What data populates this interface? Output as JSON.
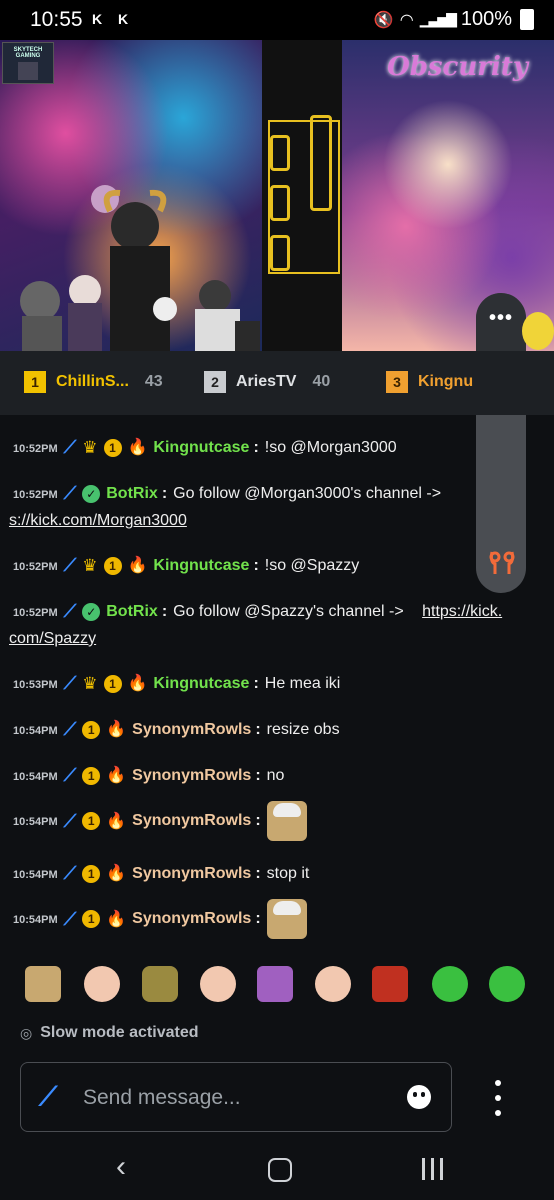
{
  "status_bar": {
    "time": "10:55",
    "notif_icons": [
      "K",
      "K"
    ],
    "battery": "100%"
  },
  "stream": {
    "overlay_title": "Obscurity",
    "sponsor_text": "SKYTECH GAMING"
  },
  "leaderboard": [
    {
      "rank": "1",
      "name": "ChillinS...",
      "count": "43",
      "color": "#f2c200"
    },
    {
      "rank": "2",
      "name": "AriesTV",
      "count": "40",
      "color": "#c9ccd0"
    },
    {
      "rank": "3",
      "name": "Kingnu",
      "count": "",
      "color": "#f0a030"
    }
  ],
  "chat": {
    "messages": [
      {
        "time": "10:52PM",
        "user": "Kingnutcase",
        "color": "#72e24c",
        "text": "!so @Morgan3000"
      },
      {
        "time": "10:52PM",
        "user": "BotRix",
        "color": "#72e24c",
        "text": "Go follow @Morgan3000's channel ->",
        "link": "s://kick.com/Morgan3000"
      },
      {
        "time": "10:52PM",
        "user": "Kingnutcase",
        "color": "#72e24c",
        "text": "!so @Spazzy"
      },
      {
        "time": "10:52PM",
        "user": "BotRix",
        "color": "#72e24c",
        "text": "Go follow @Spazzy's channel ->",
        "link_a": "https://kick.",
        "link_b": "com/Spazzy"
      },
      {
        "time": "10:53PM",
        "user": "Kingnutcase",
        "color": "#72e24c",
        "text": "He mea iki"
      },
      {
        "time": "10:54PM",
        "user": "SynonymRowls",
        "color": "#f0c8a0",
        "text": "resize obs"
      },
      {
        "time": "10:54PM",
        "user": "SynonymRowls",
        "color": "#f0c8a0",
        "text": "no"
      },
      {
        "time": "10:54PM",
        "user": "SynonymRowls",
        "color": "#f0c8a0",
        "text": ""
      },
      {
        "time": "10:54PM",
        "user": "SynonymRowls",
        "color": "#f0c8a0",
        "text": "stop it"
      },
      {
        "time": "10:54PM",
        "user": "SynonymRowls",
        "color": "#f0c8a0",
        "text": ""
      }
    ]
  },
  "slow_mode_text": "Slow mode activated",
  "composer": {
    "placeholder": "Send message..."
  },
  "colors": {
    "background": "#0e1013",
    "accent_blue": "#3a8bff",
    "username_green": "#72e24c"
  }
}
